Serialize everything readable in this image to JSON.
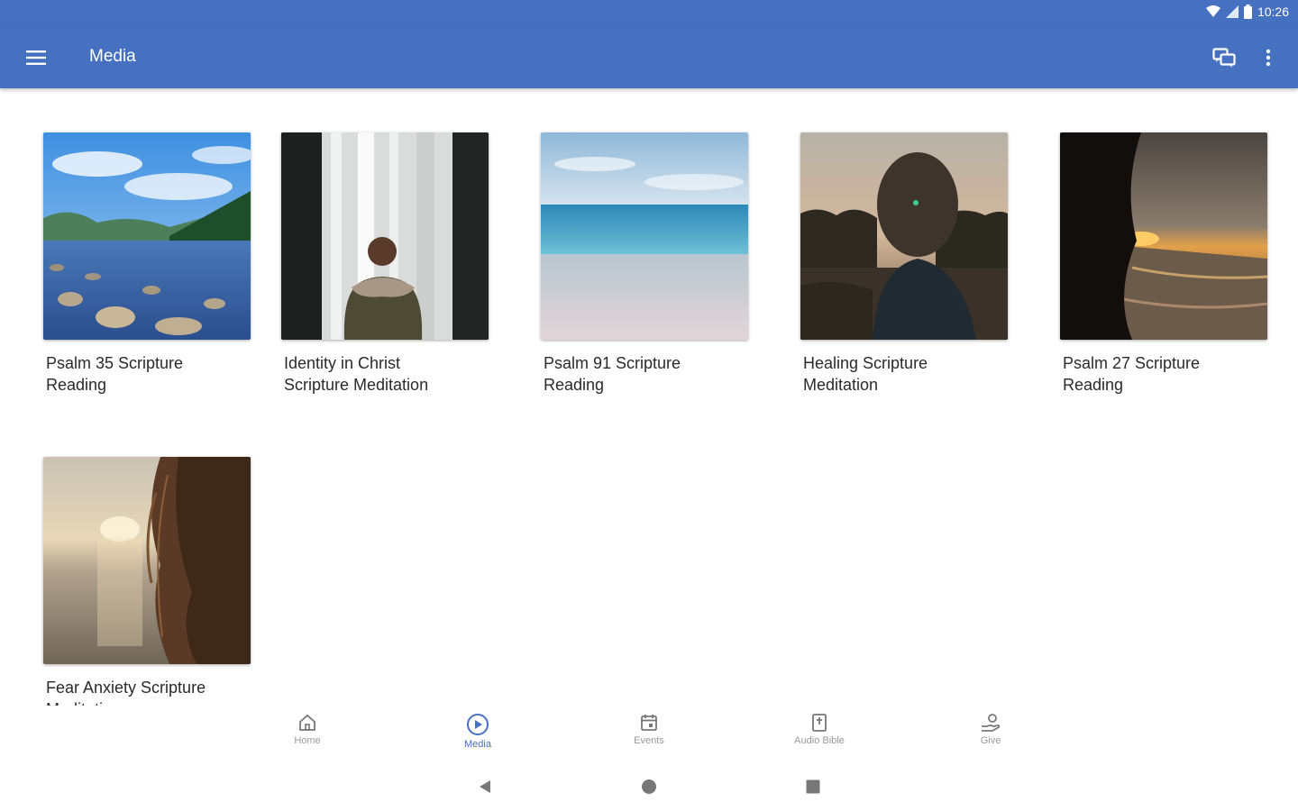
{
  "status": {
    "time": "10:26"
  },
  "appbar": {
    "title": "Media"
  },
  "media_items": [
    {
      "title_line1": "Psalm 35 Scripture",
      "title_line2": "Reading"
    },
    {
      "title_line1": "Identity in Christ",
      "title_line2": "Scripture Meditation"
    },
    {
      "title_line1": "Psalm 91 Scripture",
      "title_line2": "Reading"
    },
    {
      "title_line1": "Healing Scripture",
      "title_line2": "Meditation"
    },
    {
      "title_line1": "Psalm 27 Scripture",
      "title_line2": "Reading"
    },
    {
      "title_line1": "Fear Anxiety Scripture",
      "title_line2": "Meditation"
    }
  ],
  "bottom_nav": [
    {
      "label": "Home",
      "icon": "home-icon"
    },
    {
      "label": "Media",
      "icon": "play-circle-icon",
      "active": true
    },
    {
      "label": "Events",
      "icon": "calendar-icon"
    },
    {
      "label": "Audio Bible",
      "icon": "bible-icon"
    },
    {
      "label": "Give",
      "icon": "give-hand-icon"
    }
  ],
  "colors": {
    "primary": "#4670c0",
    "text": "#2a2a2a",
    "nav_inactive": "#9a9a9a"
  }
}
